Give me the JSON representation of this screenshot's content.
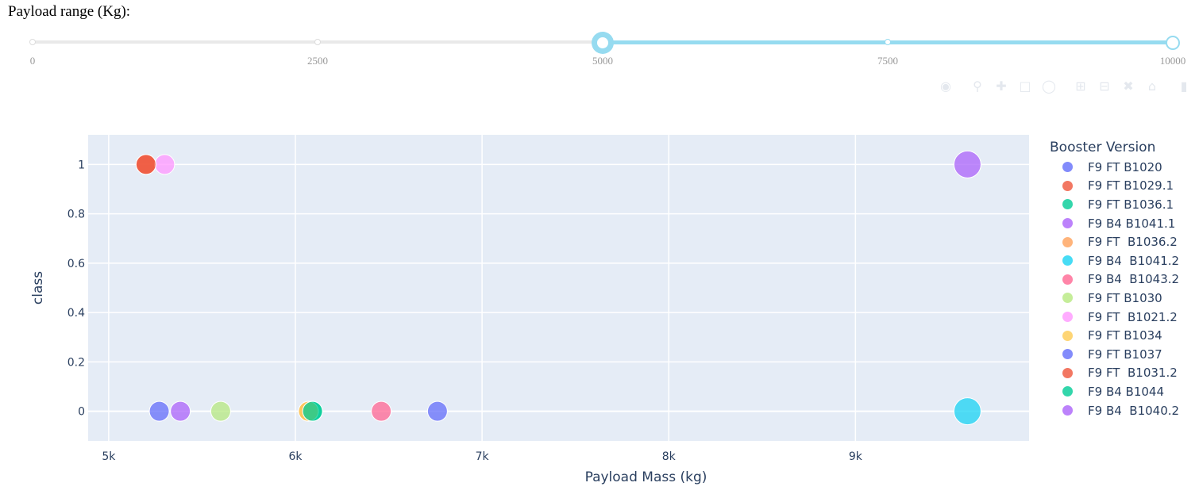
{
  "range_label": "Payload range (Kg):",
  "slider": {
    "min": 0,
    "max": 10000,
    "value": [
      5000,
      10000
    ],
    "marks": [
      "0",
      "2500",
      "5000",
      "7500",
      "10000"
    ],
    "track_color": "#96dbf0"
  },
  "modebar": {
    "icons": [
      "camera-icon",
      "zoom-icon",
      "pan-icon",
      "box-select-icon",
      "lasso-select-icon",
      "zoom-in-icon",
      "zoom-out-icon",
      "autoscale-icon",
      "reset-axes-icon",
      "plotly-logo-icon"
    ]
  },
  "chart_data": {
    "type": "scatter",
    "xlabel": "Payload Mass (kg)",
    "ylabel": "class",
    "xlim": [
      4890,
      9930
    ],
    "ylim": [
      -0.12,
      1.12
    ],
    "x_ticks": [
      5000,
      6000,
      7000,
      8000,
      9000
    ],
    "x_tick_labels": [
      "5k",
      "6k",
      "7k",
      "8k",
      "9k"
    ],
    "y_ticks": [
      0,
      0.2,
      0.4,
      0.6,
      0.8,
      1
    ],
    "y_tick_labels": [
      "0",
      "0.2",
      "0.4",
      "0.6",
      "0.8",
      "1"
    ],
    "grid": true,
    "plot_bgcolor": "#e5ecf6",
    "legend_title": "Booster Version",
    "legend_position": "right",
    "series": [
      {
        "name": "F9 FT B1020",
        "color": "#636efa",
        "points": [
          [
            5271,
            0
          ]
        ]
      },
      {
        "name": "F9 FT B1029.1",
        "color": "#ef553b",
        "points": [
          [
            5200,
            1
          ]
        ]
      },
      {
        "name": "F9 FT B1036.1",
        "color": "#00cc96",
        "points": [
          [
            6092,
            0
          ]
        ]
      },
      {
        "name": "F9 B4 B1041.1",
        "color": "#ab63fa",
        "points": [
          [
            9600,
            1
          ]
        ]
      },
      {
        "name": "F9 FT  B1036.2",
        "color": "#ffa15a",
        "points": [
          [
            6070,
            0
          ]
        ]
      },
      {
        "name": "F9 B4  B1041.2",
        "color": "#19d3f3",
        "points": [
          [
            9600,
            0
          ]
        ]
      },
      {
        "name": "F9 B4  B1043.2",
        "color": "#ff6692",
        "points": [
          [
            6460,
            0
          ]
        ]
      },
      {
        "name": "F9 FT B1030",
        "color": "#b6e880",
        "points": [
          [
            5600,
            0
          ]
        ]
      },
      {
        "name": "F9 FT  B1021.2",
        "color": "#ff97ff",
        "points": [
          [
            5300,
            1
          ]
        ]
      },
      {
        "name": "F9 FT B1034",
        "color": "#fecb52",
        "points": [
          [
            6070,
            0
          ]
        ]
      },
      {
        "name": "F9 FT B1037",
        "color": "#636efa",
        "points": [
          [
            6761,
            0
          ]
        ]
      },
      {
        "name": "F9 FT  B1031.2",
        "color": "#ef553b",
        "points": [
          [
            5200,
            1
          ]
        ]
      },
      {
        "name": "F9 B4 B1044",
        "color": "#00cc96",
        "points": [
          [
            6092,
            0
          ]
        ]
      },
      {
        "name": "F9 B4  B1040.2",
        "color": "#ab63fa",
        "points": [
          [
            5384,
            0
          ]
        ]
      }
    ]
  }
}
